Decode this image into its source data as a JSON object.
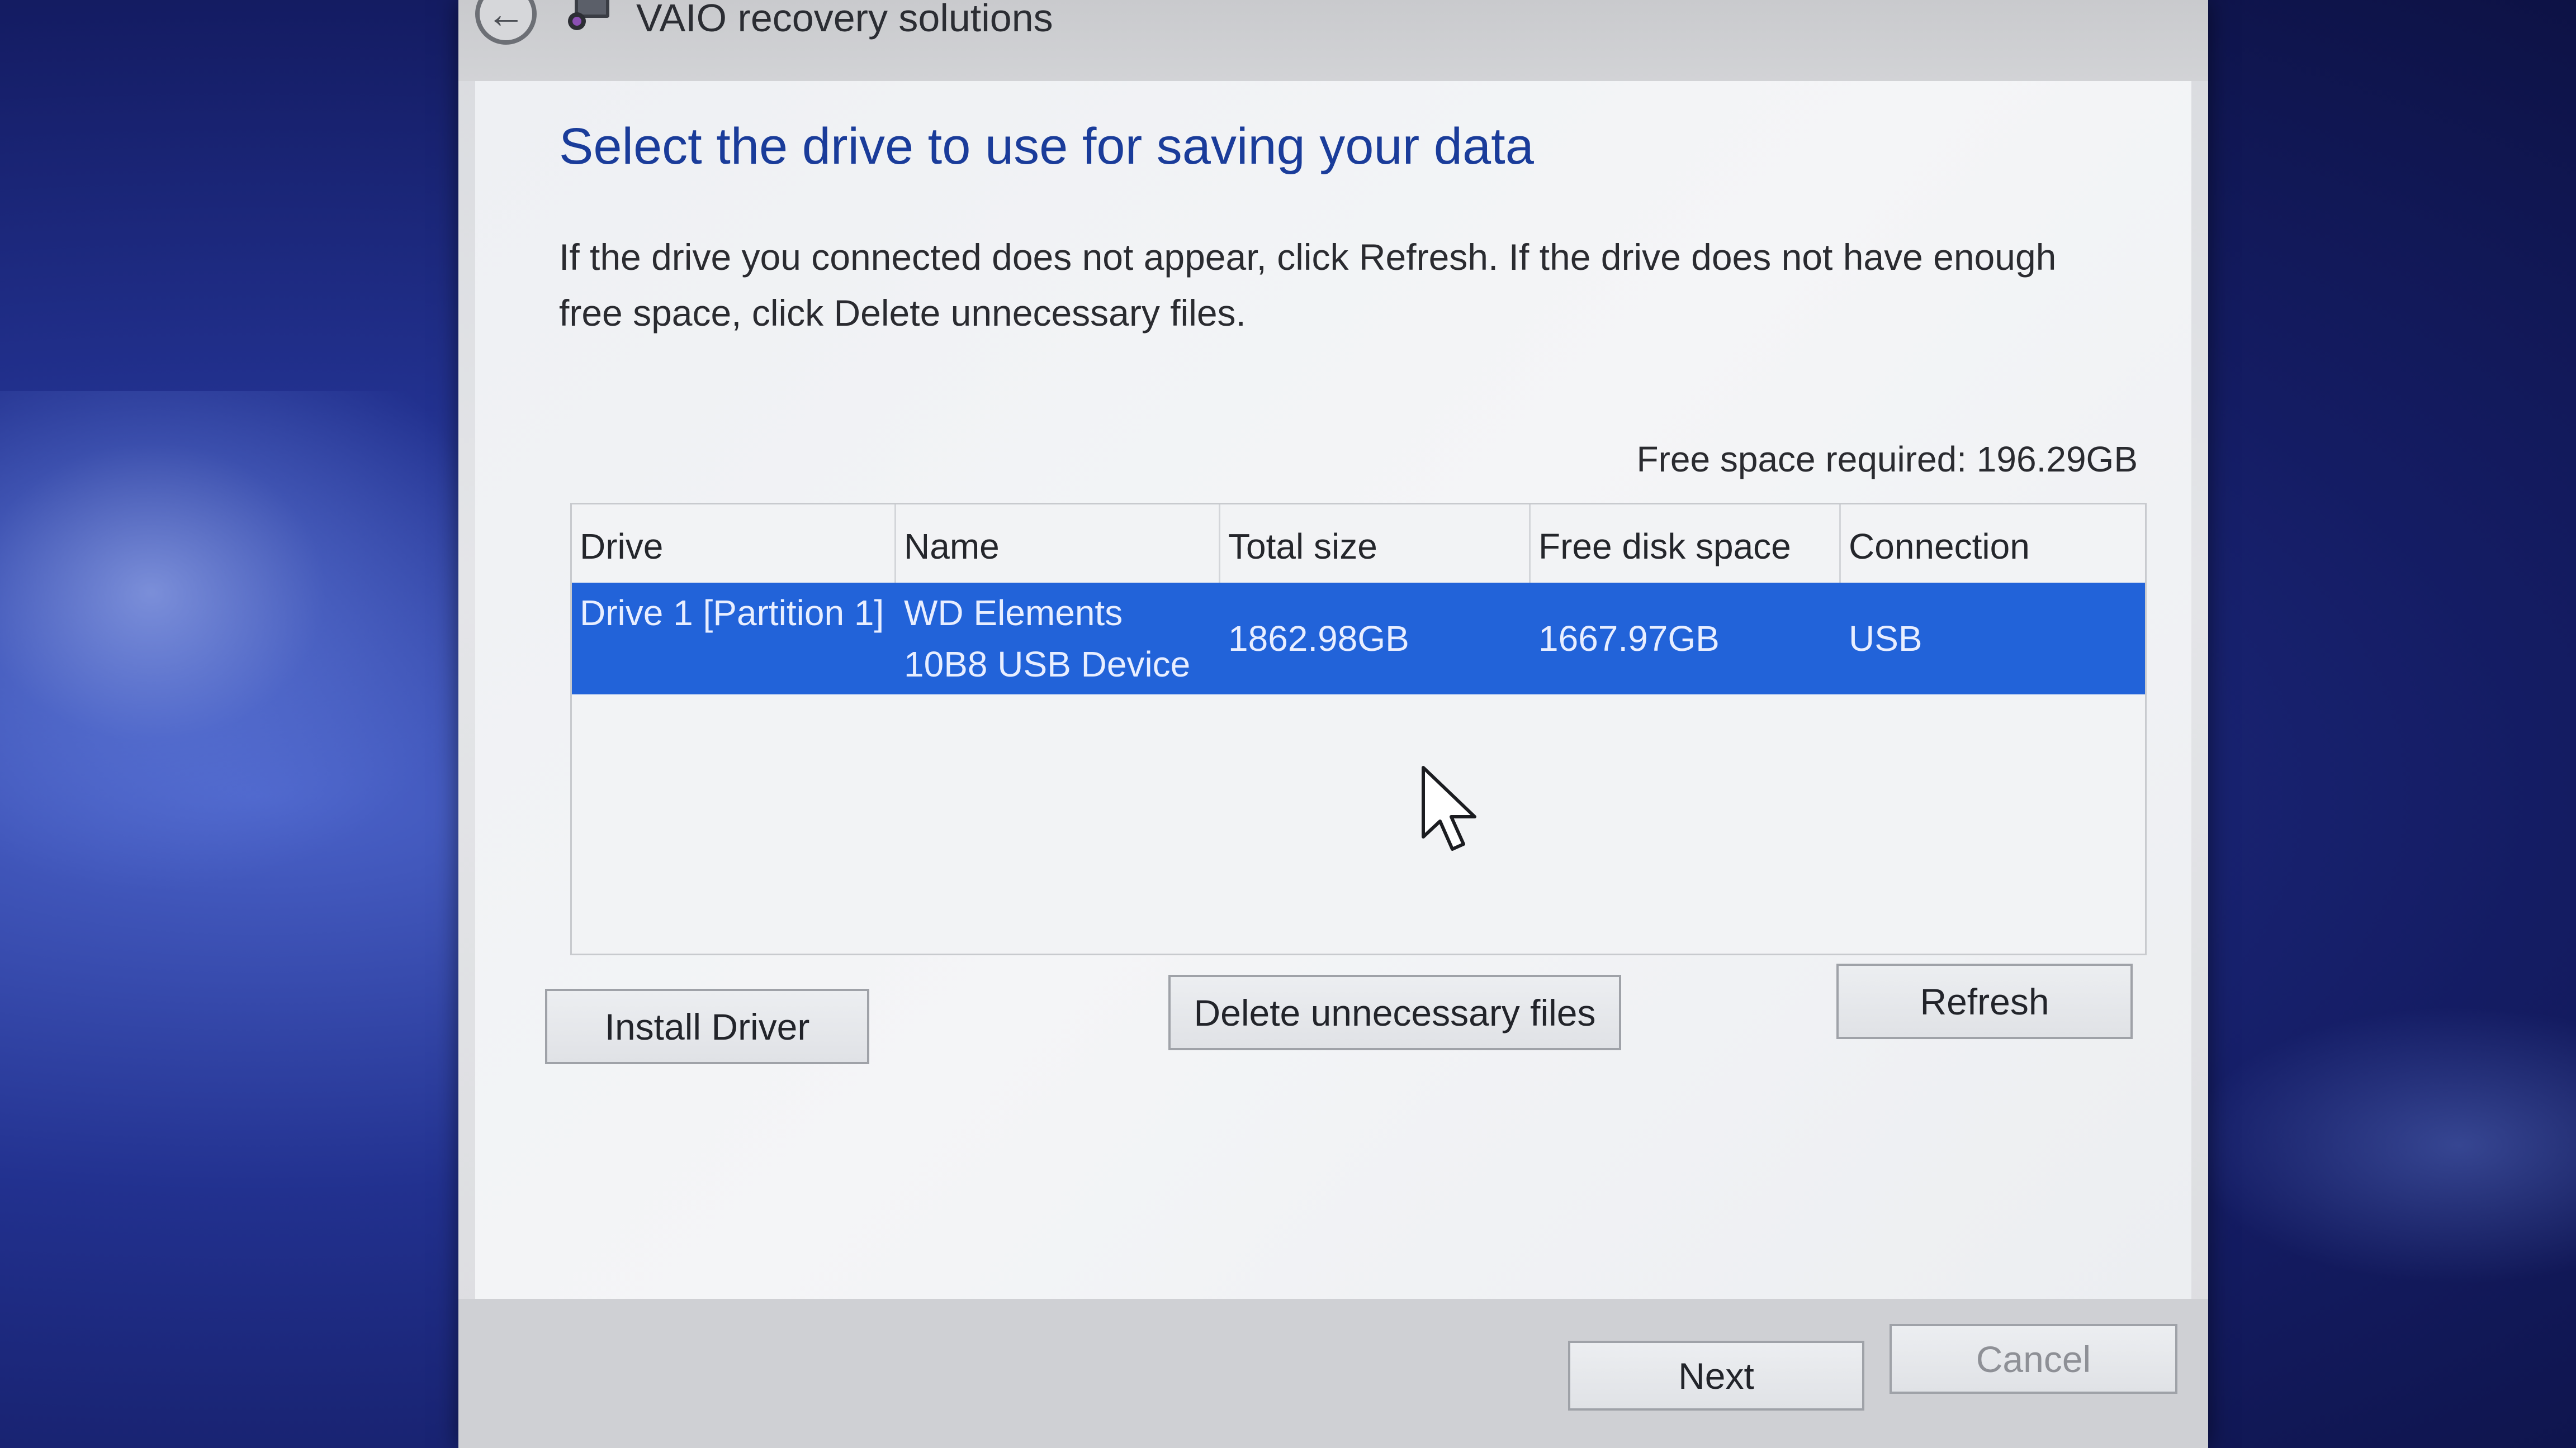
{
  "window": {
    "title": "VAIO recovery solutions"
  },
  "main": {
    "heading": "Select the drive to use for saving your data",
    "description": "If the drive you connected does not appear, click Refresh. If the drive does not have enough free space, click Delete unnecessary files.",
    "free_space_required": "Free space required: 196.29GB"
  },
  "table": {
    "columns": [
      "Drive",
      "Name",
      "Total size",
      "Free disk space",
      "Connection"
    ],
    "rows": [
      {
        "drive": "Drive 1 [Partition 1]",
        "name": "WD Elements 10B8 USB Device",
        "total_size": "1862.98GB",
        "free_disk_space": "1667.97GB",
        "connection": "USB",
        "selected": true
      }
    ]
  },
  "buttons": {
    "install_driver": "Install Driver",
    "delete_unnecessary": "Delete unnecessary files",
    "refresh": "Refresh",
    "next": "Next",
    "cancel": "Cancel"
  },
  "colors": {
    "heading": "#1a3c9a",
    "selection": "#2263d9"
  },
  "icons": {
    "back": "back-arrow-icon",
    "app": "vaio-app-icon",
    "cursor": "mouse-pointer-icon"
  }
}
